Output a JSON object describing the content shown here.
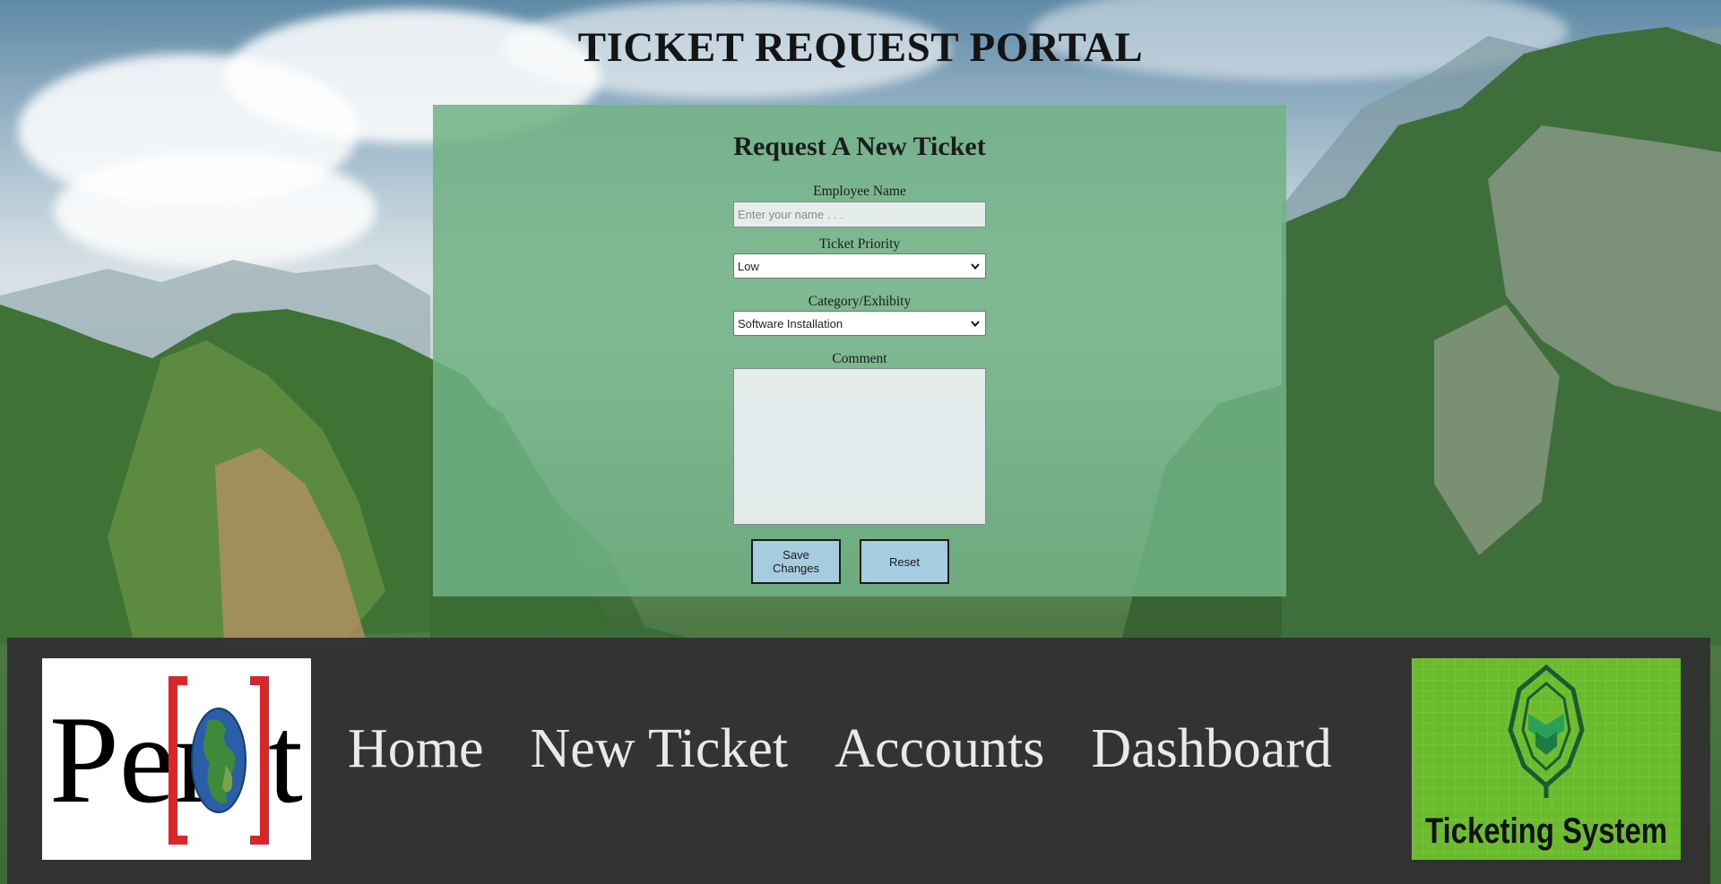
{
  "page": {
    "title": "TICKET REQUEST PORTAL"
  },
  "form": {
    "heading": "Request A New Ticket",
    "employee_name": {
      "label": "Employee Name",
      "placeholder": "Enter your name . . .",
      "value": ""
    },
    "priority": {
      "label": "Ticket Priority",
      "selected": "Low"
    },
    "category": {
      "label": "Category/Exhibity",
      "selected": "Software Installation"
    },
    "comment": {
      "label": "Comment",
      "value": ""
    },
    "buttons": {
      "save_line1": "Save",
      "save_line2": "Changes",
      "reset": "Reset"
    }
  },
  "nav": {
    "items": [
      {
        "label": "Home"
      },
      {
        "label": "New Ticket"
      },
      {
        "label": "Accounts"
      },
      {
        "label": "Dashboard"
      }
    ]
  },
  "logos": {
    "left": {
      "text_prefix": "Per",
      "text_suffix": "t",
      "icon": "globe-icon"
    },
    "right": {
      "text": "Ticketing System",
      "icon": "shield-ticket-icon"
    }
  },
  "colors": {
    "panel": "#70b284",
    "button": "#a6ccdf",
    "footer": "#323232",
    "nav_text": "#e9e9e9",
    "logo_bracket": "#d8262a",
    "logo_right_bg": "#6cbb2e"
  }
}
